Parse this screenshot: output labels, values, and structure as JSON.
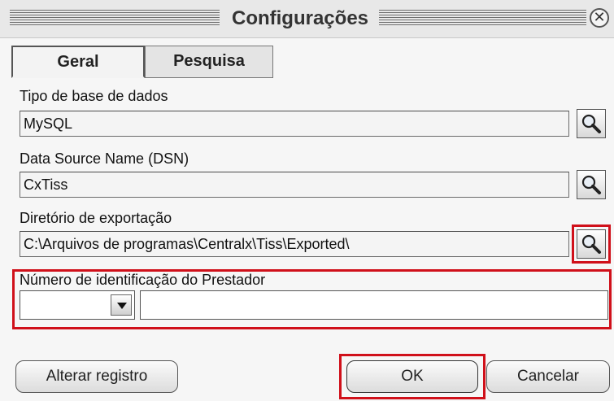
{
  "window": {
    "title": "Configurações"
  },
  "tabs": [
    {
      "label": "Geral"
    },
    {
      "label": "Pesquisa"
    }
  ],
  "fields": {
    "db_type": {
      "label": "Tipo de base de dados",
      "value": "MySQL"
    },
    "dsn": {
      "label": "Data Source Name (DSN)",
      "value": "CxTiss"
    },
    "export_dir": {
      "label": "Diretório de exportação",
      "value": "C:\\Arquivos de programas\\Centralx\\Tiss\\Exported\\"
    },
    "provider_id": {
      "label": "Número de identificação do Prestador",
      "type_value": "",
      "number_value": ""
    }
  },
  "buttons": {
    "change_registry": "Alterar registro",
    "ok": "OK",
    "cancel": "Cancelar"
  },
  "colors": {
    "highlight": "#d0101a"
  },
  "icons": {
    "close": "close-circle-icon",
    "browse": "magnifier-icon",
    "dropdown": "triangle-down-icon"
  }
}
